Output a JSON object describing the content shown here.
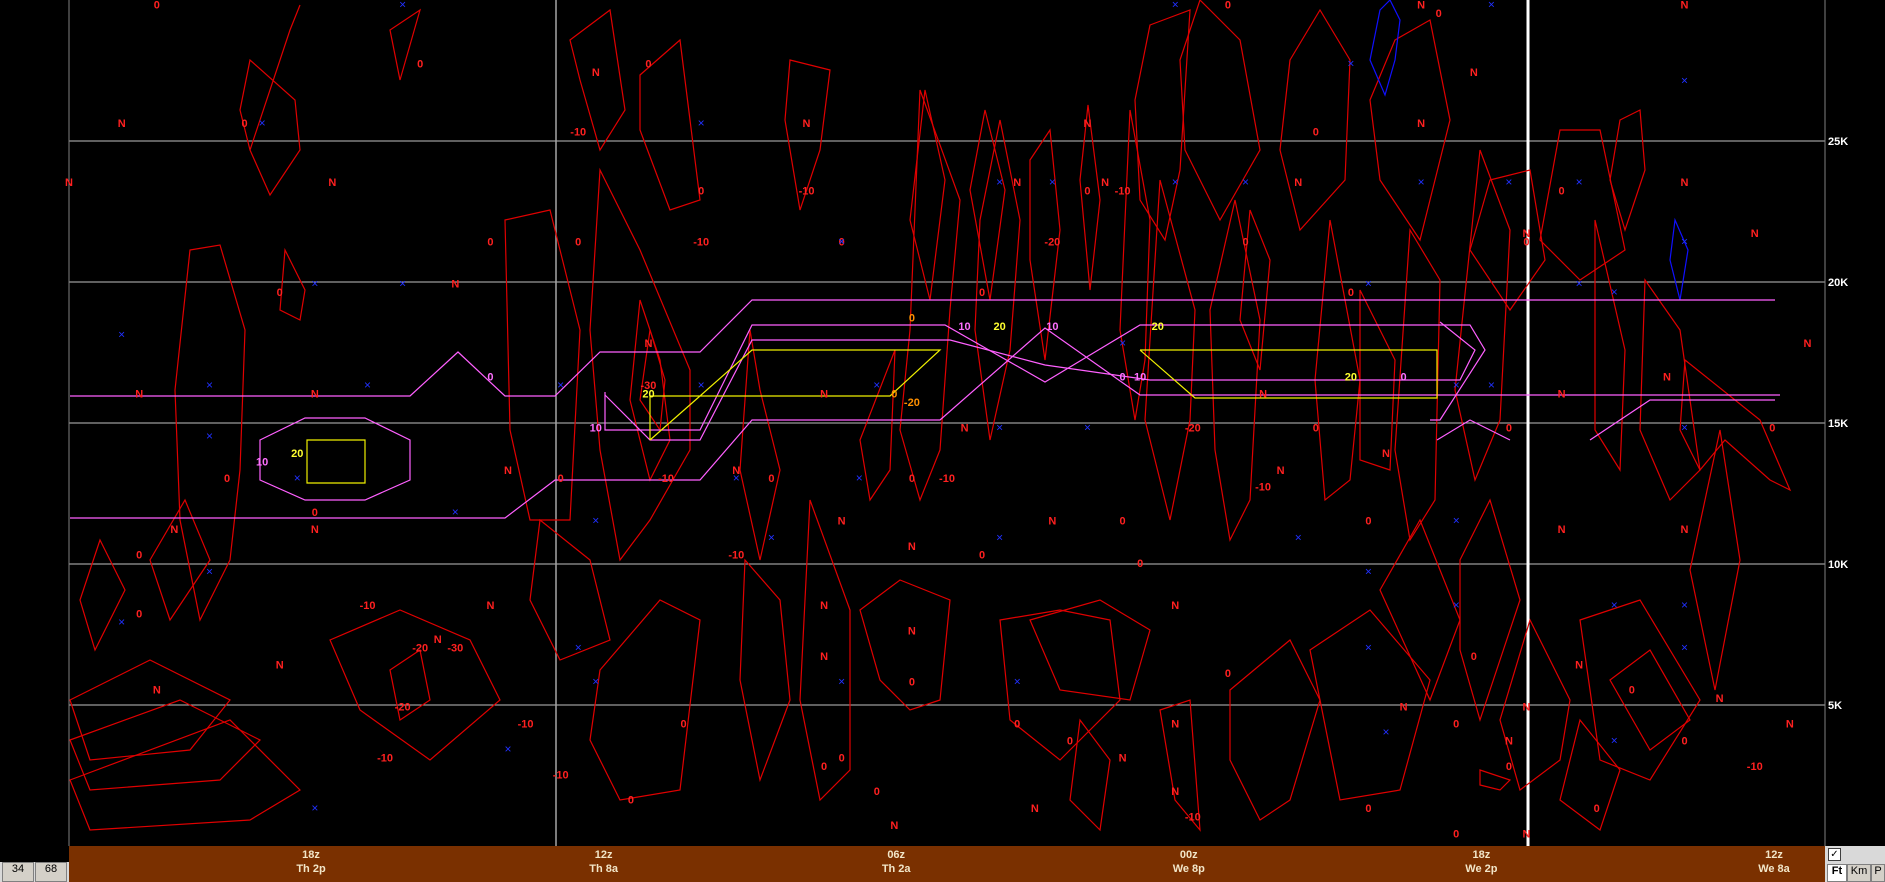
{
  "chart_data": {
    "type": "contour",
    "y_ticks": [
      "25K",
      "20K",
      "15K",
      "10K",
      "5K"
    ],
    "y_values": [
      25000,
      20000,
      15000,
      10000,
      5000
    ],
    "ylim": [
      0,
      30000
    ],
    "time_axis": [
      {
        "hour": "18z",
        "local": "Th 2p"
      },
      {
        "hour": "12z",
        "local": "Th 8a"
      },
      {
        "hour": "06z",
        "local": "Th 2a"
      },
      {
        "hour": "00z",
        "local": "We 8p"
      },
      {
        "hour": "18z",
        "local": "We 2p"
      },
      {
        "hour": "12z",
        "local": "We 8a"
      }
    ],
    "red_labels": [
      {
        "t": "0",
        "x": 0.05,
        "y": 0.99
      },
      {
        "t": "0",
        "x": 0.2,
        "y": 0.92
      },
      {
        "t": "0",
        "x": 0.33,
        "y": 0.92
      },
      {
        "t": "0",
        "x": 0.66,
        "y": 0.99
      },
      {
        "t": "0",
        "x": 0.78,
        "y": 0.98
      },
      {
        "t": "N",
        "x": 0.3,
        "y": 0.91
      },
      {
        "t": "N",
        "x": 0.8,
        "y": 0.91
      },
      {
        "t": "N",
        "x": 0.77,
        "y": 0.99
      },
      {
        "t": "N",
        "x": 0.92,
        "y": 0.99
      },
      {
        "t": "N",
        "x": 0.03,
        "y": 0.85
      },
      {
        "t": "0",
        "x": 0.1,
        "y": 0.85
      },
      {
        "t": "-10",
        "x": 0.29,
        "y": 0.84
      },
      {
        "t": "N",
        "x": 0.42,
        "y": 0.85
      },
      {
        "t": "N",
        "x": 0.58,
        "y": 0.85
      },
      {
        "t": "0",
        "x": 0.71,
        "y": 0.84
      },
      {
        "t": "N",
        "x": 0.77,
        "y": 0.85
      },
      {
        "t": "N",
        "x": 0,
        "y": 0.78
      },
      {
        "t": "N",
        "x": 0.15,
        "y": 0.78
      },
      {
        "t": "0",
        "x": 0.36,
        "y": 0.77
      },
      {
        "t": "-10",
        "x": 0.42,
        "y": 0.77
      },
      {
        "t": "N",
        "x": 0.54,
        "y": 0.78
      },
      {
        "t": "N",
        "x": 0.59,
        "y": 0.78
      },
      {
        "t": "0",
        "x": 0.58,
        "y": 0.77
      },
      {
        "t": "-10",
        "x": 0.6,
        "y": 0.77
      },
      {
        "t": "N",
        "x": 0.7,
        "y": 0.78
      },
      {
        "t": "0",
        "x": 0.85,
        "y": 0.77
      },
      {
        "t": "N",
        "x": 0.92,
        "y": 0.78
      },
      {
        "t": "0",
        "x": 0.24,
        "y": 0.71
      },
      {
        "t": "0",
        "x": 0.29,
        "y": 0.71
      },
      {
        "t": "-10",
        "x": 0.36,
        "y": 0.71
      },
      {
        "t": "0",
        "x": 0.44,
        "y": 0.71
      },
      {
        "t": "-20",
        "x": 0.56,
        "y": 0.71
      },
      {
        "t": "0",
        "x": 0.67,
        "y": 0.71
      },
      {
        "t": "0",
        "x": 0.83,
        "y": 0.71
      },
      {
        "t": "N",
        "x": 0.83,
        "y": 0.72
      },
      {
        "t": "N",
        "x": 0.96,
        "y": 0.72
      },
      {
        "t": "0",
        "x": 0.12,
        "y": 0.65
      },
      {
        "t": "N",
        "x": 0.22,
        "y": 0.66
      },
      {
        "t": "0",
        "x": 0.52,
        "y": 0.65
      },
      {
        "t": "0",
        "x": 0.73,
        "y": 0.65
      },
      {
        "t": "N",
        "x": 0.33,
        "y": 0.59
      },
      {
        "t": "N",
        "x": 0.99,
        "y": 0.59
      },
      {
        "t": "N",
        "x": 0.14,
        "y": 0.53
      },
      {
        "t": "-30",
        "x": 0.33,
        "y": 0.54
      },
      {
        "t": "N",
        "x": 0.43,
        "y": 0.53
      },
      {
        "t": "N",
        "x": 0.68,
        "y": 0.53
      },
      {
        "t": "N",
        "x": 0.04,
        "y": 0.53
      },
      {
        "t": "N",
        "x": 0.85,
        "y": 0.53
      },
      {
        "t": "N",
        "x": 0.91,
        "y": 0.55
      },
      {
        "t": "N",
        "x": 0.51,
        "y": 0.49
      },
      {
        "t": "0",
        "x": 0.71,
        "y": 0.49
      },
      {
        "t": "0",
        "x": 0.82,
        "y": 0.49
      },
      {
        "t": "-20",
        "x": 0.64,
        "y": 0.49
      },
      {
        "t": "0",
        "x": 0.97,
        "y": 0.49
      },
      {
        "t": "N",
        "x": 0.75,
        "y": 0.46
      },
      {
        "t": "0",
        "x": 0.09,
        "y": 0.43
      },
      {
        "t": "N",
        "x": 0.25,
        "y": 0.44
      },
      {
        "t": "0",
        "x": 0.28,
        "y": 0.43
      },
      {
        "t": "-10",
        "x": 0.34,
        "y": 0.43
      },
      {
        "t": "N",
        "x": 0.38,
        "y": 0.44
      },
      {
        "t": "0",
        "x": 0.4,
        "y": 0.43
      },
      {
        "t": "-10",
        "x": 0.5,
        "y": 0.43
      },
      {
        "t": "0",
        "x": 0.48,
        "y": 0.43
      },
      {
        "t": "N",
        "x": 0.69,
        "y": 0.44
      },
      {
        "t": "-10",
        "x": 0.68,
        "y": 0.42
      },
      {
        "t": "0",
        "x": 0.14,
        "y": 0.39
      },
      {
        "t": "N",
        "x": 0.06,
        "y": 0.37
      },
      {
        "t": "N",
        "x": 0.14,
        "y": 0.37
      },
      {
        "t": "N",
        "x": 0.44,
        "y": 0.38
      },
      {
        "t": "N",
        "x": 0.56,
        "y": 0.38
      },
      {
        "t": "0",
        "x": 0.6,
        "y": 0.38
      },
      {
        "t": "0",
        "x": 0.74,
        "y": 0.38
      },
      {
        "t": "N",
        "x": 0.85,
        "y": 0.37
      },
      {
        "t": "N",
        "x": 0.92,
        "y": 0.37
      },
      {
        "t": "0",
        "x": 0.04,
        "y": 0.34
      },
      {
        "t": "-10",
        "x": 0.38,
        "y": 0.34
      },
      {
        "t": "N",
        "x": 0.48,
        "y": 0.35
      },
      {
        "t": "0",
        "x": 0.52,
        "y": 0.34
      },
      {
        "t": "0",
        "x": 0.61,
        "y": 0.33
      },
      {
        "t": "0",
        "x": 0.04,
        "y": 0.27
      },
      {
        "t": "-10",
        "x": 0.17,
        "y": 0.28
      },
      {
        "t": "-20",
        "x": 0.2,
        "y": 0.23
      },
      {
        "t": "-30",
        "x": 0.22,
        "y": 0.23
      },
      {
        "t": "N",
        "x": 0.21,
        "y": 0.24
      },
      {
        "t": "N",
        "x": 0.12,
        "y": 0.21
      },
      {
        "t": "N",
        "x": 0.24,
        "y": 0.28
      },
      {
        "t": "N",
        "x": 0.43,
        "y": 0.28
      },
      {
        "t": "N",
        "x": 0.43,
        "y": 0.22
      },
      {
        "t": "N",
        "x": 0.48,
        "y": 0.25
      },
      {
        "t": "0",
        "x": 0.48,
        "y": 0.19
      },
      {
        "t": "N",
        "x": 0.63,
        "y": 0.28
      },
      {
        "t": "0",
        "x": 0.66,
        "y": 0.2
      },
      {
        "t": "0",
        "x": 0.8,
        "y": 0.22
      },
      {
        "t": "N",
        "x": 0.86,
        "y": 0.21
      },
      {
        "t": "N",
        "x": 0.94,
        "y": 0.17
      },
      {
        "t": "0",
        "x": 0.89,
        "y": 0.18
      },
      {
        "t": "N",
        "x": 0.05,
        "y": 0.18
      },
      {
        "t": "-20",
        "x": 0.19,
        "y": 0.16
      },
      {
        "t": "-10",
        "x": 0.26,
        "y": 0.14
      },
      {
        "t": "0",
        "x": 0.35,
        "y": 0.14
      },
      {
        "t": "0",
        "x": 0.54,
        "y": 0.14
      },
      {
        "t": "N",
        "x": 0.63,
        "y": 0.14
      },
      {
        "t": "0",
        "x": 0.79,
        "y": 0.14
      },
      {
        "t": "N",
        "x": 0.76,
        "y": 0.16
      },
      {
        "t": "N",
        "x": 0.83,
        "y": 0.16
      },
      {
        "t": "N",
        "x": 0.98,
        "y": 0.14
      },
      {
        "t": "-10",
        "x": 0.18,
        "y": 0.1
      },
      {
        "t": "-10",
        "x": 0.28,
        "y": 0.08
      },
      {
        "t": "0",
        "x": 0.44,
        "y": 0.1
      },
      {
        "t": "N",
        "x": 0.6,
        "y": 0.1
      },
      {
        "t": "-10",
        "x": 0.96,
        "y": 0.09
      },
      {
        "t": "0",
        "x": 0.43,
        "y": 0.09
      },
      {
        "t": "N",
        "x": 0.82,
        "y": 0.12
      },
      {
        "t": "0",
        "x": 0.92,
        "y": 0.12
      },
      {
        "t": "0",
        "x": 0.82,
        "y": 0.09
      },
      {
        "t": "0",
        "x": 0.57,
        "y": 0.12
      },
      {
        "t": "N",
        "x": 0.47,
        "y": 0.02
      },
      {
        "t": "N",
        "x": 0.55,
        "y": 0.04
      },
      {
        "t": "N",
        "x": 0.63,
        "y": 0.06
      },
      {
        "t": "-10",
        "x": 0.64,
        "y": 0.03
      },
      {
        "t": "0",
        "x": 0.32,
        "y": 0.05
      },
      {
        "t": "0",
        "x": 0.46,
        "y": 0.06
      },
      {
        "t": "0",
        "x": 0.74,
        "y": 0.04
      },
      {
        "t": "0",
        "x": 0.87,
        "y": 0.04
      },
      {
        "t": "0",
        "x": 0.79,
        "y": 0.01
      },
      {
        "t": "N",
        "x": 0.83,
        "y": 0.01
      }
    ],
    "blue_markers": [
      {
        "x": 0.19,
        "y": 0.99
      },
      {
        "x": 0.63,
        "y": 0.99
      },
      {
        "x": 0.81,
        "y": 0.99
      },
      {
        "x": 0.73,
        "y": 0.92
      },
      {
        "x": 0.92,
        "y": 0.9
      },
      {
        "x": 0.11,
        "y": 0.85
      },
      {
        "x": 0.36,
        "y": 0.85
      },
      {
        "x": 0.53,
        "y": 0.78
      },
      {
        "x": 0.56,
        "y": 0.78
      },
      {
        "x": 0.63,
        "y": 0.78
      },
      {
        "x": 0.67,
        "y": 0.78
      },
      {
        "x": 0.77,
        "y": 0.78
      },
      {
        "x": 0.82,
        "y": 0.78
      },
      {
        "x": 0.86,
        "y": 0.78
      },
      {
        "x": 0.44,
        "y": 0.71
      },
      {
        "x": 0.92,
        "y": 0.71
      },
      {
        "x": 0.14,
        "y": 0.66
      },
      {
        "x": 0.19,
        "y": 0.66
      },
      {
        "x": 0.74,
        "y": 0.66
      },
      {
        "x": 0.86,
        "y": 0.66
      },
      {
        "x": 0.88,
        "y": 0.65
      },
      {
        "x": 0.03,
        "y": 0.6
      },
      {
        "x": 0.08,
        "y": 0.54
      },
      {
        "x": 0.17,
        "y": 0.54
      },
      {
        "x": 0.28,
        "y": 0.54
      },
      {
        "x": 0.36,
        "y": 0.54
      },
      {
        "x": 0.46,
        "y": 0.54
      },
      {
        "x": 0.6,
        "y": 0.59
      },
      {
        "x": 0.79,
        "y": 0.54
      },
      {
        "x": 0.81,
        "y": 0.54
      },
      {
        "x": 0.08,
        "y": 0.48
      },
      {
        "x": 0.53,
        "y": 0.49
      },
      {
        "x": 0.58,
        "y": 0.49
      },
      {
        "x": 0.92,
        "y": 0.49
      },
      {
        "x": 0.13,
        "y": 0.43
      },
      {
        "x": 0.38,
        "y": 0.43
      },
      {
        "x": 0.45,
        "y": 0.43
      },
      {
        "x": 0.22,
        "y": 0.39
      },
      {
        "x": 0.3,
        "y": 0.38
      },
      {
        "x": 0.4,
        "y": 0.36
      },
      {
        "x": 0.53,
        "y": 0.36
      },
      {
        "x": 0.7,
        "y": 0.36
      },
      {
        "x": 0.79,
        "y": 0.38
      },
      {
        "x": 0.08,
        "y": 0.32
      },
      {
        "x": 0.74,
        "y": 0.32
      },
      {
        "x": 0.79,
        "y": 0.28
      },
      {
        "x": 0.88,
        "y": 0.28
      },
      {
        "x": 0.92,
        "y": 0.28
      },
      {
        "x": 0.74,
        "y": 0.23
      },
      {
        "x": 0.92,
        "y": 0.23
      },
      {
        "x": 0.03,
        "y": 0.26
      },
      {
        "x": 0.3,
        "y": 0.19
      },
      {
        "x": 0.44,
        "y": 0.19
      },
      {
        "x": 0.54,
        "y": 0.19
      },
      {
        "x": 0.75,
        "y": 0.13
      },
      {
        "x": 0.88,
        "y": 0.12
      },
      {
        "x": 0.29,
        "y": 0.23
      },
      {
        "x": 0.14,
        "y": 0.04
      },
      {
        "x": 0.25,
        "y": 0.11
      }
    ],
    "yellow_labels": [
      {
        "t": "20",
        "x": 0.53,
        "y": 0.61
      },
      {
        "t": "20",
        "x": 0.62,
        "y": 0.61
      },
      {
        "t": "20",
        "x": 0.73,
        "y": 0.55
      },
      {
        "t": "20",
        "x": 0.33,
        "y": 0.53
      },
      {
        "t": "20",
        "x": 0.13,
        "y": 0.46
      }
    ],
    "orange_labels": [
      {
        "t": "0",
        "x": 0.48,
        "y": 0.62
      },
      {
        "t": "-20",
        "x": 0.48,
        "y": 0.52
      },
      {
        "t": "0",
        "x": 0.47,
        "y": 0.53
      }
    ],
    "magenta_labels": [
      {
        "t": "0",
        "x": 0.24,
        "y": 0.55
      },
      {
        "t": "10",
        "x": 0.51,
        "y": 0.61
      },
      {
        "t": "10",
        "x": 0.56,
        "y": 0.61
      },
      {
        "t": "0",
        "x": 0.6,
        "y": 0.55
      },
      {
        "t": "10",
        "x": 0.61,
        "y": 0.55
      },
      {
        "t": "10",
        "x": 0.3,
        "y": 0.49
      },
      {
        "t": "10",
        "x": 0.11,
        "y": 0.45
      },
      {
        "t": "0",
        "x": 0.76,
        "y": 0.55
      }
    ]
  },
  "panels": {
    "left_buttons": [
      "34",
      "68"
    ],
    "unit_buttons": [
      "Ft",
      "Km",
      "P"
    ],
    "checkbox_mark": "✓"
  }
}
